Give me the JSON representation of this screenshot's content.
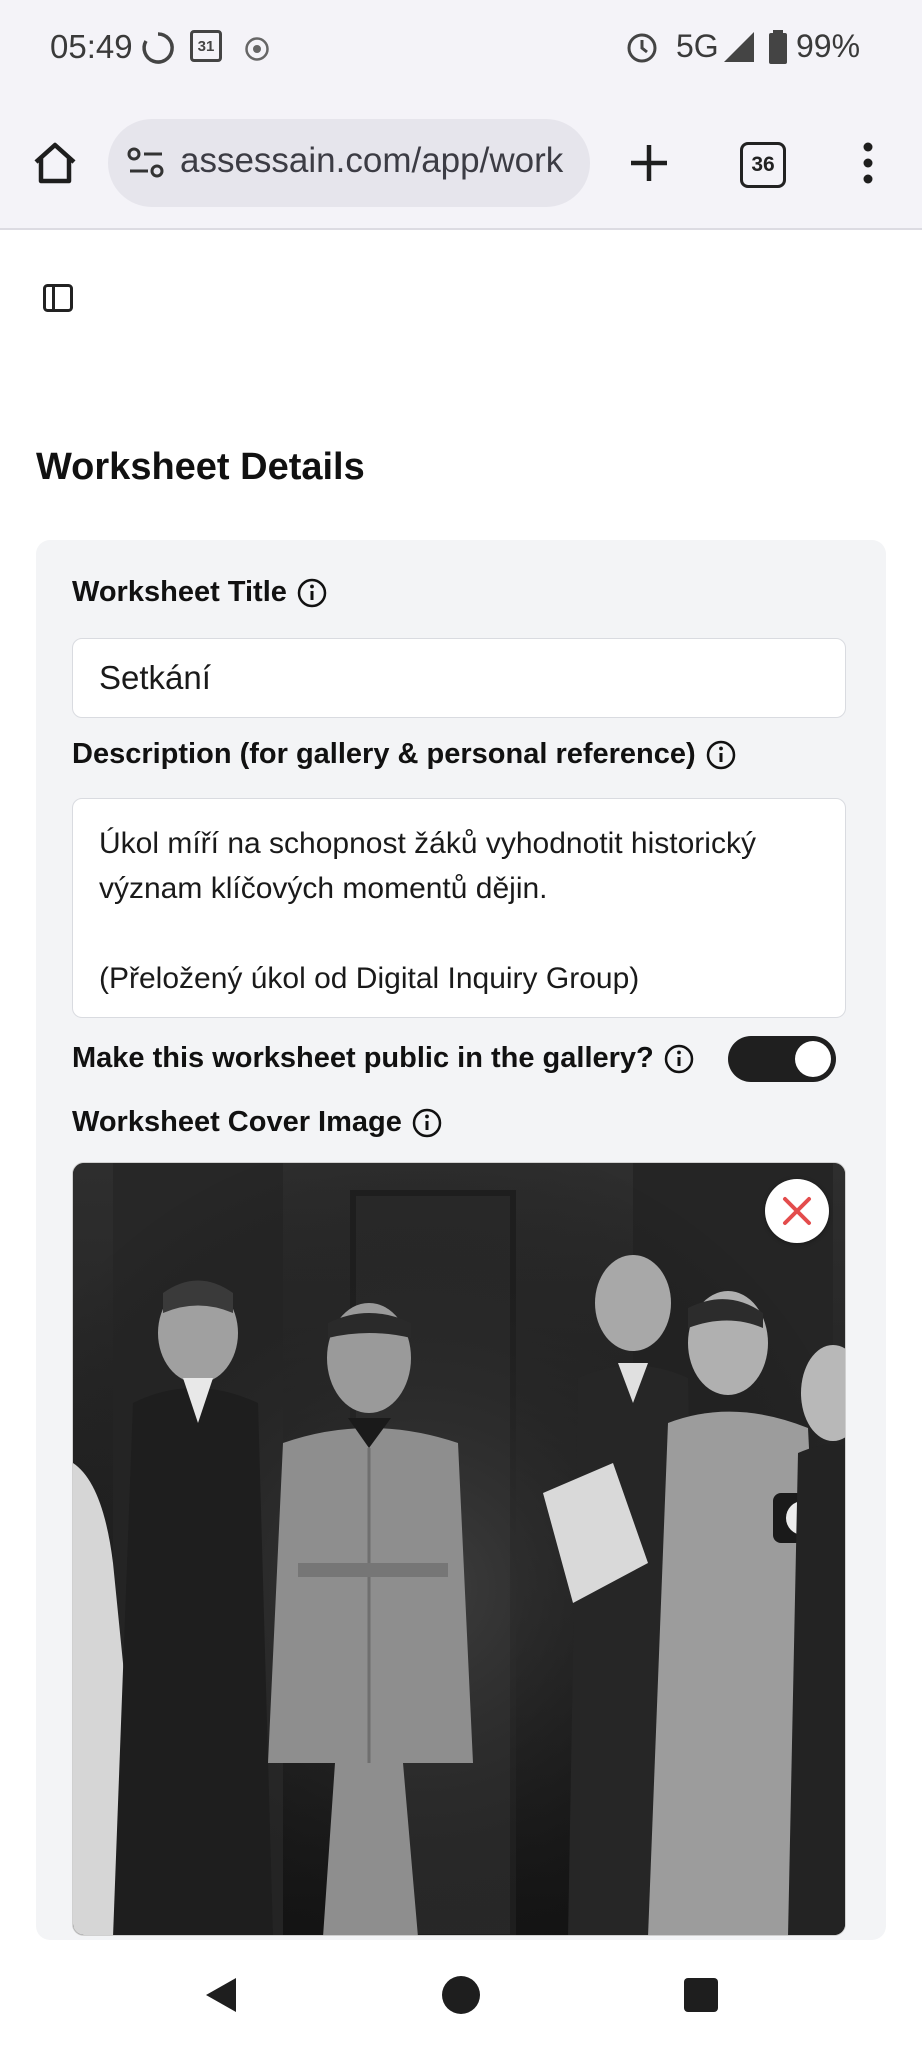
{
  "status": {
    "time": "05:49",
    "calendar_day": "31",
    "network": "5G",
    "battery": "99%"
  },
  "browser": {
    "url": "assessain.com/app/work",
    "tab_count": "36"
  },
  "page": {
    "title": "Worksheet Details"
  },
  "form": {
    "title_label": "Worksheet Title",
    "title_value": "Setkání",
    "description_label": "Description (for gallery & personal reference)",
    "description_value": "Úkol míří na schopnost žáků vyhodnotit historický význam klíčových momentů dějin.\n\n(Přeložený úkol od Digital Inquiry Group)",
    "public_label": "Make this worksheet public in the gallery?",
    "public_enabled": true,
    "cover_label": "Worksheet Cover Image"
  },
  "icons": {
    "home": "home-icon",
    "site_settings": "site-settings-icon",
    "new_tab": "plus-icon",
    "menu": "more-vert-icon",
    "sidebar": "sidebar-toggle-icon",
    "info": "info-icon",
    "remove": "close-icon"
  },
  "colors": {
    "toggle_on": "#1f1f1f",
    "remove_icon": "#e34c4c",
    "card_bg": "#f3f4f6"
  }
}
